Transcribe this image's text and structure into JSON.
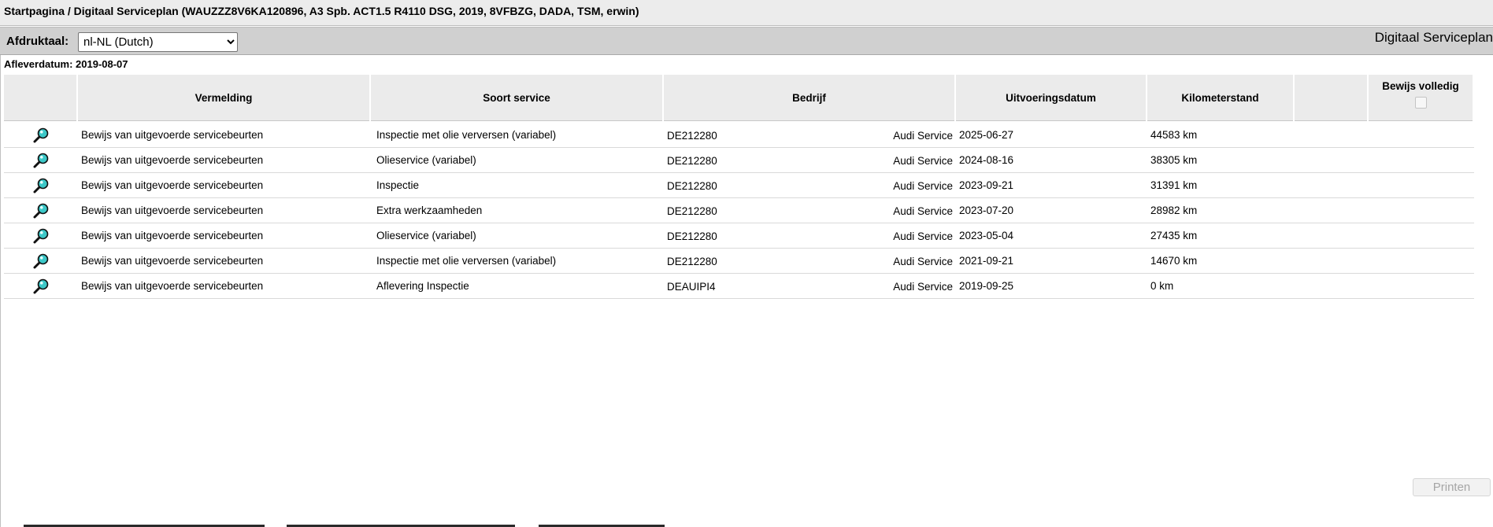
{
  "header": {
    "breadcrumb": "Startpagina / Digitaal Serviceplan (WAUZZZ8V6KA120896, A3 Spb. ACT1.5 R4110 DSG, 2019, 8VFBZG, DADA, TSM, erwin)"
  },
  "toolbar": {
    "language_label": "Afdruktaal:",
    "language_selected": "nl-NL (Dutch)",
    "plan_title": "Digitaal Serviceplan"
  },
  "delivery_date": "Afleverdatum: 2019-08-07",
  "table": {
    "columns": {
      "vermelding": "Vermelding",
      "soort": "Soort service",
      "bedrijf": "Bedrijf",
      "datum": "Uitvoeringsdatum",
      "km": "Kilometerstand",
      "empty": "",
      "bewijs": "Bewijs volledig"
    },
    "rows": [
      {
        "entry": "Bewijs van uitgevoerde servicebeurten",
        "service": "Inspectie met olie verversen (variabel)",
        "company_code": "DE212280",
        "dealer": "Audi Service",
        "date": "2025-06-27",
        "km": "44583 km"
      },
      {
        "entry": "Bewijs van uitgevoerde servicebeurten",
        "service": "Olieservice (variabel)",
        "company_code": "DE212280",
        "dealer": "Audi Service",
        "date": "2024-08-16",
        "km": "38305 km"
      },
      {
        "entry": "Bewijs van uitgevoerde servicebeurten",
        "service": "Inspectie",
        "company_code": "DE212280",
        "dealer": "Audi Service",
        "date": "2023-09-21",
        "km": "31391 km"
      },
      {
        "entry": "Bewijs van uitgevoerde servicebeurten",
        "service": "Extra werkzaamheden",
        "company_code": "DE212280",
        "dealer": "Audi Service",
        "date": "2023-07-20",
        "km": "28982 km"
      },
      {
        "entry": "Bewijs van uitgevoerde servicebeurten",
        "service": "Olieservice (variabel)",
        "company_code": "DE212280",
        "dealer": "Audi Service",
        "date": "2023-05-04",
        "km": "27435 km"
      },
      {
        "entry": "Bewijs van uitgevoerde servicebeurten",
        "service": "Inspectie met olie verversen (variabel)",
        "company_code": "DE212280",
        "dealer": "Audi Service",
        "date": "2021-09-21",
        "km": "14670 km"
      },
      {
        "entry": "Bewijs van uitgevoerde servicebeurten",
        "service": "Aflevering Inspectie",
        "company_code": "DEAUIPI4",
        "dealer": "Audi Service",
        "date": "2019-09-25",
        "km": "0 km"
      }
    ]
  },
  "actions": {
    "print_label": "Printen"
  },
  "colors": {
    "title_bar": "#ececec",
    "toolbar": "#d0d0d0",
    "header_cell": "#ebebeb",
    "icon_lens": "#3cc8c8"
  }
}
